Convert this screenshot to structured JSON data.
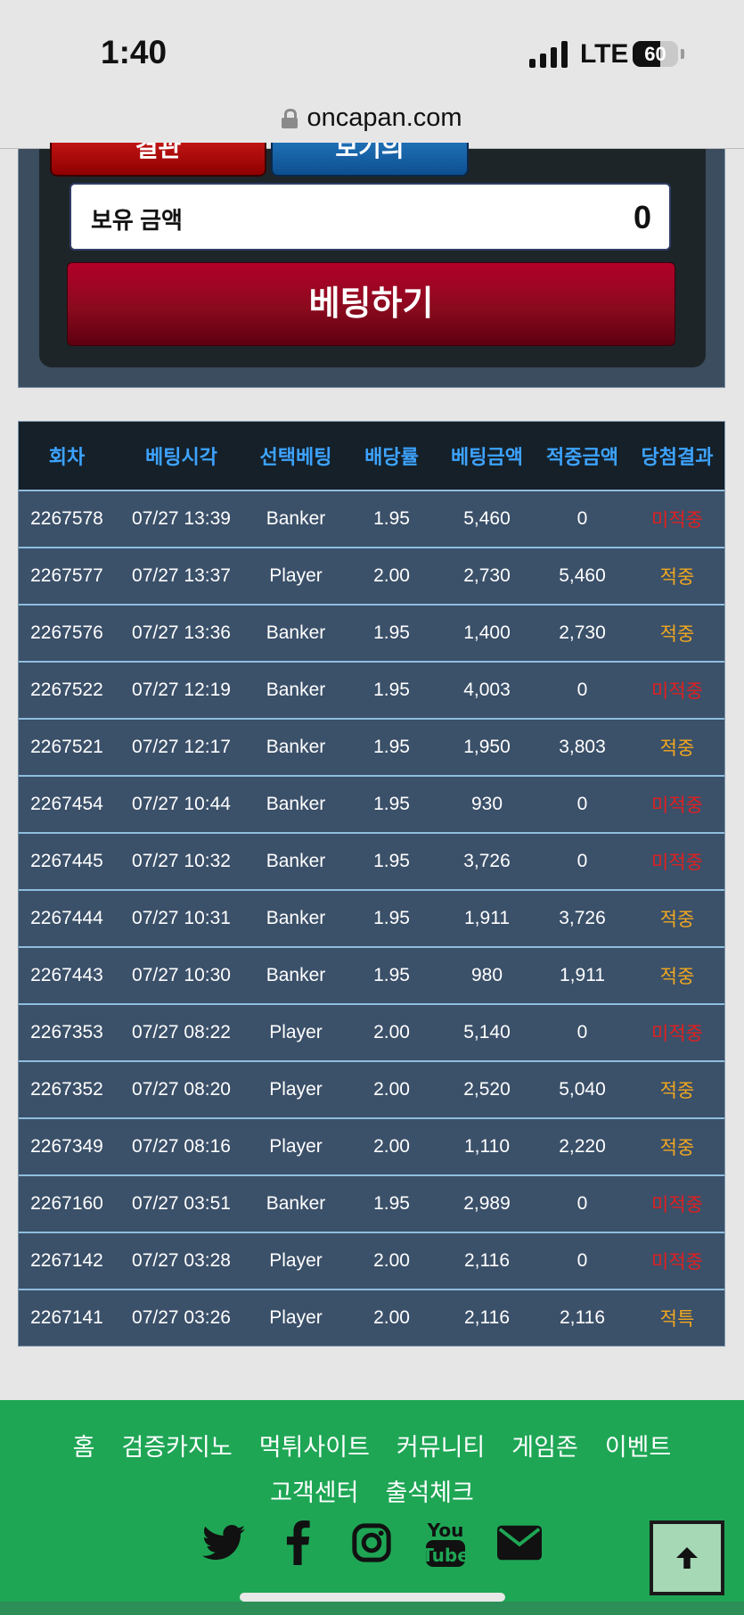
{
  "status_bar": {
    "time": "1:40",
    "network": "LTE",
    "battery": "60",
    "battery_level": 0.6
  },
  "browser": {
    "url": "oncapan.com"
  },
  "bet_panel": {
    "red_button_label": "결관",
    "blue_button_label": "보기의",
    "balance_label": "보유 금액",
    "balance_value": "0",
    "bet_button_label": "베팅하기"
  },
  "table": {
    "headers": [
      "회차",
      "베팅시각",
      "선택베팅",
      "배당률",
      "베팅금액",
      "적중금액",
      "당첨결과"
    ],
    "rows": [
      [
        "2267578",
        "07/27 13:39",
        "Banker",
        "1.95",
        "5,460",
        "0",
        "미적중"
      ],
      [
        "2267577",
        "07/27 13:37",
        "Player",
        "2.00",
        "2,730",
        "5,460",
        "적중"
      ],
      [
        "2267576",
        "07/27 13:36",
        "Banker",
        "1.95",
        "1,400",
        "2,730",
        "적중"
      ],
      [
        "2267522",
        "07/27 12:19",
        "Banker",
        "1.95",
        "4,003",
        "0",
        "미적중"
      ],
      [
        "2267521",
        "07/27 12:17",
        "Banker",
        "1.95",
        "1,950",
        "3,803",
        "적중"
      ],
      [
        "2267454",
        "07/27 10:44",
        "Banker",
        "1.95",
        "930",
        "0",
        "미적중"
      ],
      [
        "2267445",
        "07/27 10:32",
        "Banker",
        "1.95",
        "3,726",
        "0",
        "미적중"
      ],
      [
        "2267444",
        "07/27 10:31",
        "Banker",
        "1.95",
        "1,911",
        "3,726",
        "적중"
      ],
      [
        "2267443",
        "07/27 10:30",
        "Banker",
        "1.95",
        "980",
        "1,911",
        "적중"
      ],
      [
        "2267353",
        "07/27 08:22",
        "Player",
        "2.00",
        "5,140",
        "0",
        "미적중"
      ],
      [
        "2267352",
        "07/27 08:20",
        "Player",
        "2.00",
        "2,520",
        "5,040",
        "적중"
      ],
      [
        "2267349",
        "07/27 08:16",
        "Player",
        "2.00",
        "1,110",
        "2,220",
        "적중"
      ],
      [
        "2267160",
        "07/27 03:51",
        "Banker",
        "1.95",
        "2,989",
        "0",
        "미적중"
      ],
      [
        "2267142",
        "07/27 03:28",
        "Player",
        "2.00",
        "2,116",
        "0",
        "미적중"
      ],
      [
        "2267141",
        "07/27 03:26",
        "Player",
        "2.00",
        "2,116",
        "2,116",
        "적특"
      ]
    ],
    "lose_result": "미적중"
  },
  "footer": {
    "links_row1": [
      "홈",
      "검증카지노",
      "먹튀사이트",
      "커뮤니티",
      "게임존",
      "이벤트"
    ],
    "links_row2": [
      "고객센터",
      "출석체크"
    ],
    "social_icons": [
      "twitter-icon",
      "facebook-icon",
      "instagram-icon",
      "youtube-icon",
      "mail-icon"
    ]
  },
  "colors": {
    "win": "#f1a81f",
    "lose": "#e21f1f",
    "header_text": "#3da3ff",
    "footer_bg": "#1ea655"
  }
}
